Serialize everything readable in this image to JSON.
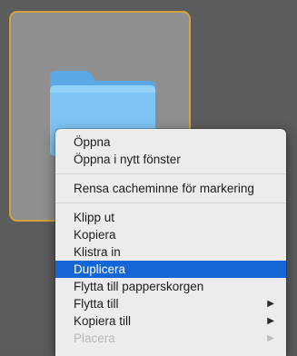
{
  "colors": {
    "desktop": "#5c5c5c",
    "selection_border": "#d6a23b",
    "folder_blue": "#7dc4f5",
    "menu_highlight": "#1466d6"
  },
  "folder": {
    "icon": "folder-icon"
  },
  "context_menu": {
    "groups": [
      [
        {
          "label": "Öppna"
        },
        {
          "label": "Öppna i nytt fönster"
        }
      ],
      [
        {
          "label": "Rensa cacheminne för markering"
        }
      ],
      [
        {
          "label": "Klipp ut"
        },
        {
          "label": "Kopiera"
        },
        {
          "label": "Klistra in"
        },
        {
          "label": "Duplicera",
          "highlighted": true
        },
        {
          "label": "Flytta till papperskorgen"
        },
        {
          "label": "Flytta till",
          "submenu": true
        },
        {
          "label": "Kopiera till",
          "submenu": true
        },
        {
          "label": "Placera",
          "submenu": true,
          "disabled": true
        }
      ]
    ],
    "submenu_arrow": "▶"
  }
}
